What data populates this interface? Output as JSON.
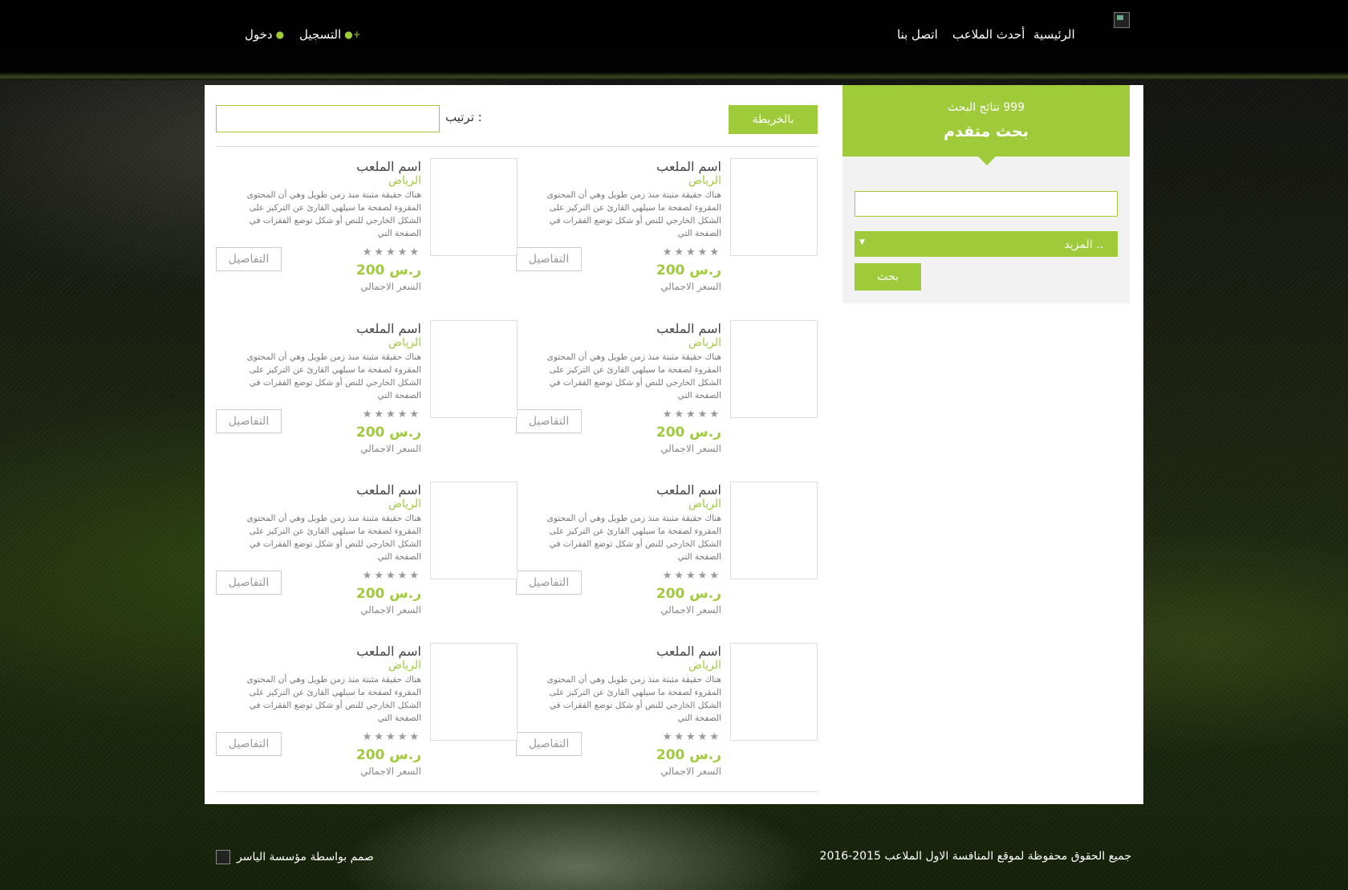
{
  "colors": {
    "accent": "#9fcb3b"
  },
  "header": {
    "nav": [
      {
        "label": "الرئيسية"
      },
      {
        "label": "أحدث الملاعب"
      },
      {
        "label": "اتصل بنا"
      }
    ],
    "register_label": "التسجيل",
    "login_label": "دخول"
  },
  "sidebar": {
    "results_count": "999 نتائج البحث",
    "title": "بحث متقدم",
    "select_label": "المزيد ..",
    "search_button": "بحث"
  },
  "toolbar": {
    "map_button": "بالخريطة",
    "sort_label": "ترتيب :"
  },
  "cards": [
    {
      "name": "اسم الملعب",
      "city": "الرياض",
      "desc": "هناك حقيقة مثبتة منذ زمن طويل وهي أن المحتوى المقروء لصفحة ما سيلهي القارئ عن التركيز على الشكل الخارجي للنص أو شكل توضع الفقرات في الصفحة التي",
      "stars": "★★★★★",
      "price": "200 ر.س",
      "total_label": "السعر الاجمالي",
      "details_button": "التفاصيل"
    },
    {
      "name": "اسم الملعب",
      "city": "الرياض",
      "desc": "هناك حقيقة مثبتة منذ زمن طويل وهي أن المحتوى المقروء لصفحة ما سيلهي القارئ عن التركيز على الشكل الخارجي للنص أو شكل توضع الفقرات في الصفحة التي",
      "stars": "★★★★★",
      "price": "200 ر.س",
      "total_label": "السعر الاجمالي",
      "details_button": "التفاصيل"
    },
    {
      "name": "اسم الملعب",
      "city": "الرياض",
      "desc": "هناك حقيقة مثبتة منذ زمن طويل وهي أن المحتوى المقروء لصفحة ما سيلهي القارئ عن التركيز على الشكل الخارجي للنص أو شكل توضع الفقرات في الصفحة التي",
      "stars": "★★★★★",
      "price": "200 ر.س",
      "total_label": "السعر الاجمالي",
      "details_button": "التفاصيل"
    },
    {
      "name": "اسم الملعب",
      "city": "الرياض",
      "desc": "هناك حقيقة مثبتة منذ زمن طويل وهي أن المحتوى المقروء لصفحة ما سيلهي القارئ عن التركيز على الشكل الخارجي للنص أو شكل توضع الفقرات في الصفحة التي",
      "stars": "★★★★★",
      "price": "200 ر.س",
      "total_label": "السعر الاجمالي",
      "details_button": "التفاصيل"
    },
    {
      "name": "اسم الملعب",
      "city": "الرياض",
      "desc": "هناك حقيقة مثبتة منذ زمن طويل وهي أن المحتوى المقروء لصفحة ما سيلهي القارئ عن التركيز على الشكل الخارجي للنص أو شكل توضع الفقرات في الصفحة التي",
      "stars": "★★★★★",
      "price": "200 ر.س",
      "total_label": "السعر الاجمالي",
      "details_button": "التفاصيل"
    },
    {
      "name": "اسم الملعب",
      "city": "الرياض",
      "desc": "هناك حقيقة مثبتة منذ زمن طويل وهي أن المحتوى المقروء لصفحة ما سيلهي القارئ عن التركيز على الشكل الخارجي للنص أو شكل توضع الفقرات في الصفحة التي",
      "stars": "★★★★★",
      "price": "200 ر.س",
      "total_label": "السعر الاجمالي",
      "details_button": "التفاصيل"
    },
    {
      "name": "اسم الملعب",
      "city": "الرياض",
      "desc": "هناك حقيقة مثبتة منذ زمن طويل وهي أن المحتوى المقروء لصفحة ما سيلهي القارئ عن التركيز على الشكل الخارجي للنص أو شكل توضع الفقرات في الصفحة التي",
      "stars": "★★★★★",
      "price": "200 ر.س",
      "total_label": "السعر الاجمالي",
      "details_button": "التفاصيل"
    },
    {
      "name": "اسم الملعب",
      "city": "الرياض",
      "desc": "هناك حقيقة مثبتة منذ زمن طويل وهي أن المحتوى المقروء لصفحة ما سيلهي القارئ عن التركيز على الشكل الخارجي للنص أو شكل توضع الفقرات في الصفحة التي",
      "stars": "★★★★★",
      "price": "200 ر.س",
      "total_label": "السعر الاجمالي",
      "details_button": "التفاصيل"
    }
  ],
  "footer": {
    "designed_by": "صمم بواسطة مؤسسة الياسر",
    "copyright": "جميع الحقوق محفوظة لموقع المنافسة الاول الملاعب 2015-2016"
  }
}
